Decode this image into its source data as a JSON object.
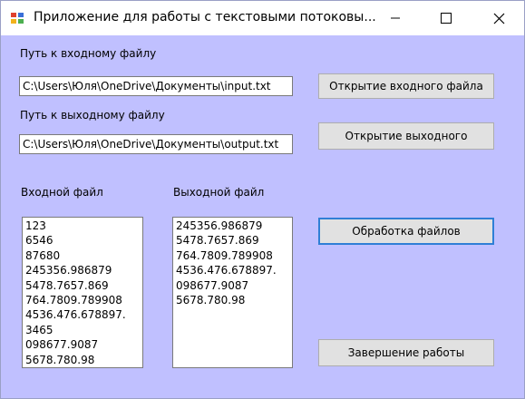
{
  "window": {
    "title": "Приложение для работы с  текстовыми потоковы..."
  },
  "icons": {
    "app": "app-form-icon",
    "minimize": "minimize-icon",
    "maximize": "maximize-icon",
    "close": "close-icon"
  },
  "form": {
    "input_path_label": "Путь к входному файлу",
    "input_path_value": "C:\\Users\\Юля\\OneDrive\\Документы\\input.txt",
    "open_input_button": "Открытие входного файла",
    "output_path_label": "Путь к выходному файлу",
    "output_path_value": "C:\\Users\\Юля\\OneDrive\\Документы\\output.txt",
    "open_output_button": "Открытие выходного",
    "input_file_label": "Входной файл",
    "output_file_label": "Выходной файл",
    "input_file_lines": [
      "123",
      "6546",
      "87680",
      "245356.986879",
      "5478.7657.869",
      "764.7809.789908",
      "4536.476.678897.",
      "3465",
      "098677.9087",
      "5678.780.98"
    ],
    "output_file_lines": [
      "245356.986879",
      "5478.7657.869",
      "764.7809.789908",
      "4536.476.678897.",
      "098677.9087",
      "5678.780.98"
    ],
    "process_button": "Обработка файлов",
    "exit_button": "Завершение работы"
  },
  "colors": {
    "form_background": "#c0c0ff",
    "focus_border": "#2f7fd6"
  }
}
